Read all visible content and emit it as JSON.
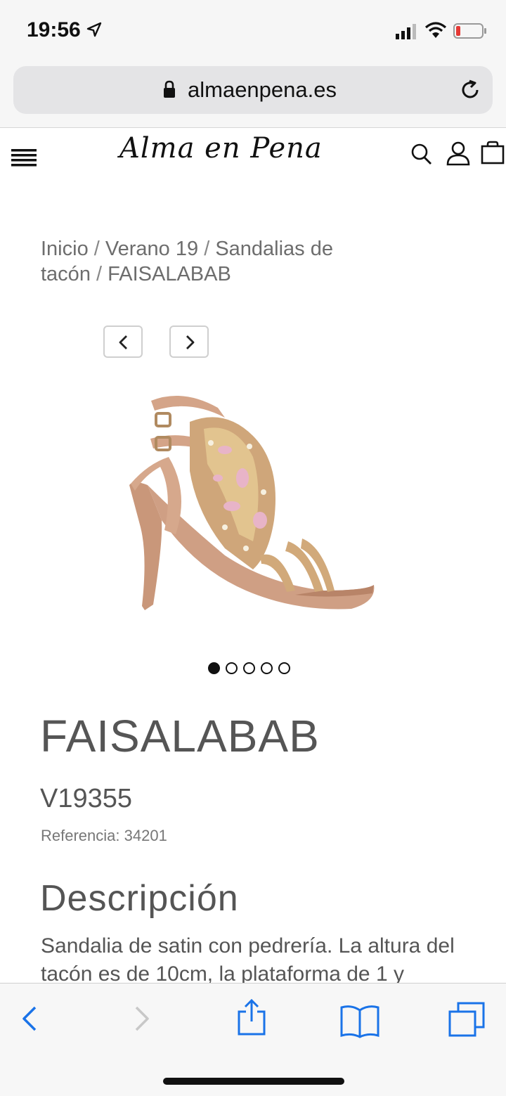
{
  "status_bar": {
    "time": "19:56"
  },
  "browser": {
    "url": "almaenpena.es"
  },
  "site": {
    "logo_text": "Alma en Pena"
  },
  "breadcrumb": {
    "items": [
      "Inicio",
      "Verano 19",
      "Sandalias de tacón",
      "FAISALABAB"
    ],
    "separator": "/"
  },
  "carousel": {
    "total_images": 5,
    "active_index": 0
  },
  "product": {
    "name": "FAISALABAB",
    "model": "V19355",
    "reference_label": "Referencia:",
    "reference_value": "34201",
    "description_heading": "Descripción",
    "description_text": "Sandalia de satin con pedrería. La altura del tacón es de 10cm, la plataforma de 1 y"
  },
  "colors": {
    "toolbar_accent": "#1a73e8",
    "text": "#555555"
  }
}
